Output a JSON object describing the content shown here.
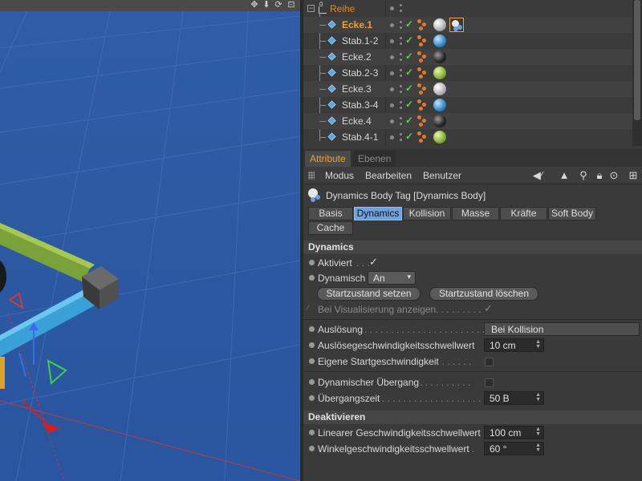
{
  "viewport": {
    "nav_icons": [
      "move-view-icon",
      "zoom-view-icon",
      "rotate-view-icon",
      "maximize-view-icon"
    ],
    "nav_glyphs": [
      "✥",
      "⬇",
      "⟳",
      "⊡"
    ]
  },
  "object_manager": {
    "root": {
      "name": "Reihe",
      "layer_mark": "0"
    },
    "rows": [
      {
        "name": "Ecke.1",
        "selected": true,
        "material": "white",
        "has_dynamics_tag": true
      },
      {
        "name": "Stab.1-2",
        "selected": false,
        "material": "blue",
        "has_dynamics_tag": false
      },
      {
        "name": "Ecke.2",
        "selected": false,
        "material": "black",
        "has_dynamics_tag": false
      },
      {
        "name": "Stab.2-3",
        "selected": false,
        "material": "green",
        "has_dynamics_tag": false
      },
      {
        "name": "Ecke.3",
        "selected": false,
        "material": "white",
        "has_dynamics_tag": false
      },
      {
        "name": "Stab.3-4",
        "selected": false,
        "material": "blue",
        "has_dynamics_tag": false
      },
      {
        "name": "Ecke.4",
        "selected": false,
        "material": "black",
        "has_dynamics_tag": false
      },
      {
        "name": "Stab.4-1",
        "selected": false,
        "material": "green",
        "has_dynamics_tag": false
      }
    ],
    "check_glyph": "✓"
  },
  "attributes": {
    "tabs": {
      "attribute": "Attribute",
      "layers": "Ebenen"
    },
    "menu": {
      "mode": "Modus",
      "edit": "Bearbeiten",
      "user": "Benutzer"
    },
    "tag_title": "Dynamics Body Tag [Dynamics Body]",
    "subtabs": [
      "Basis",
      "Dynamics",
      "Kollision",
      "Masse",
      "Kräfte",
      "Soft Body",
      "Cache"
    ],
    "active_subtab": "Dynamics",
    "dynamics": {
      "heading": "Dynamics",
      "enabled_label": "Aktiviert",
      "enabled_leader": " . . .",
      "enabled_value": "✓",
      "dynamic_label": "Dynamisch",
      "dynamic_value": "An",
      "set_initial_state": "Startzustand setzen",
      "clear_initial_state": "Startzustand löschen",
      "show_in_viewport_label": "Bei Visualisierung anzeigen",
      "show_in_viewport_leader": " . . . . . . . . .",
      "show_in_viewport_value": "✓",
      "trigger_label": "Auslösung",
      "trigger_leader": " . . . . . . . . . . . . . . . . . . . . . . . . . .",
      "trigger_value": "Bei Kollision",
      "trigger_velocity_label": "Auslösegeschwindigkeitsschwellwert",
      "trigger_velocity_value": "10 cm",
      "custom_initial_velocity_label": "Eigene Startgeschwindigkeit",
      "custom_initial_velocity_leader": " . . . . . . .",
      "dynamic_transition_label": "Dynamischer Übergang",
      "dynamic_transition_leader": " . . . . . . . . . .",
      "transition_time_label": "Übergangszeit",
      "transition_time_leader": " . . . . . . . . . . . . . . . . . . . . .",
      "transition_time_value": "50 B"
    },
    "deactivation": {
      "heading": "Deaktivieren",
      "linear_threshold_label": "Linearer Geschwindigkeitsschwellwert",
      "linear_threshold_value": "100 cm",
      "angular_threshold_label": "Winkelgeschwindigkeitsschwellwert",
      "angular_threshold_leader": " .",
      "angular_threshold_value": "60 °"
    }
  },
  "colors": {
    "accent_orange": "#f0a030",
    "active_subtab": "#6fa3dd",
    "viewport_blue": "#2c5aa3",
    "check_green": "#5fd04a"
  }
}
